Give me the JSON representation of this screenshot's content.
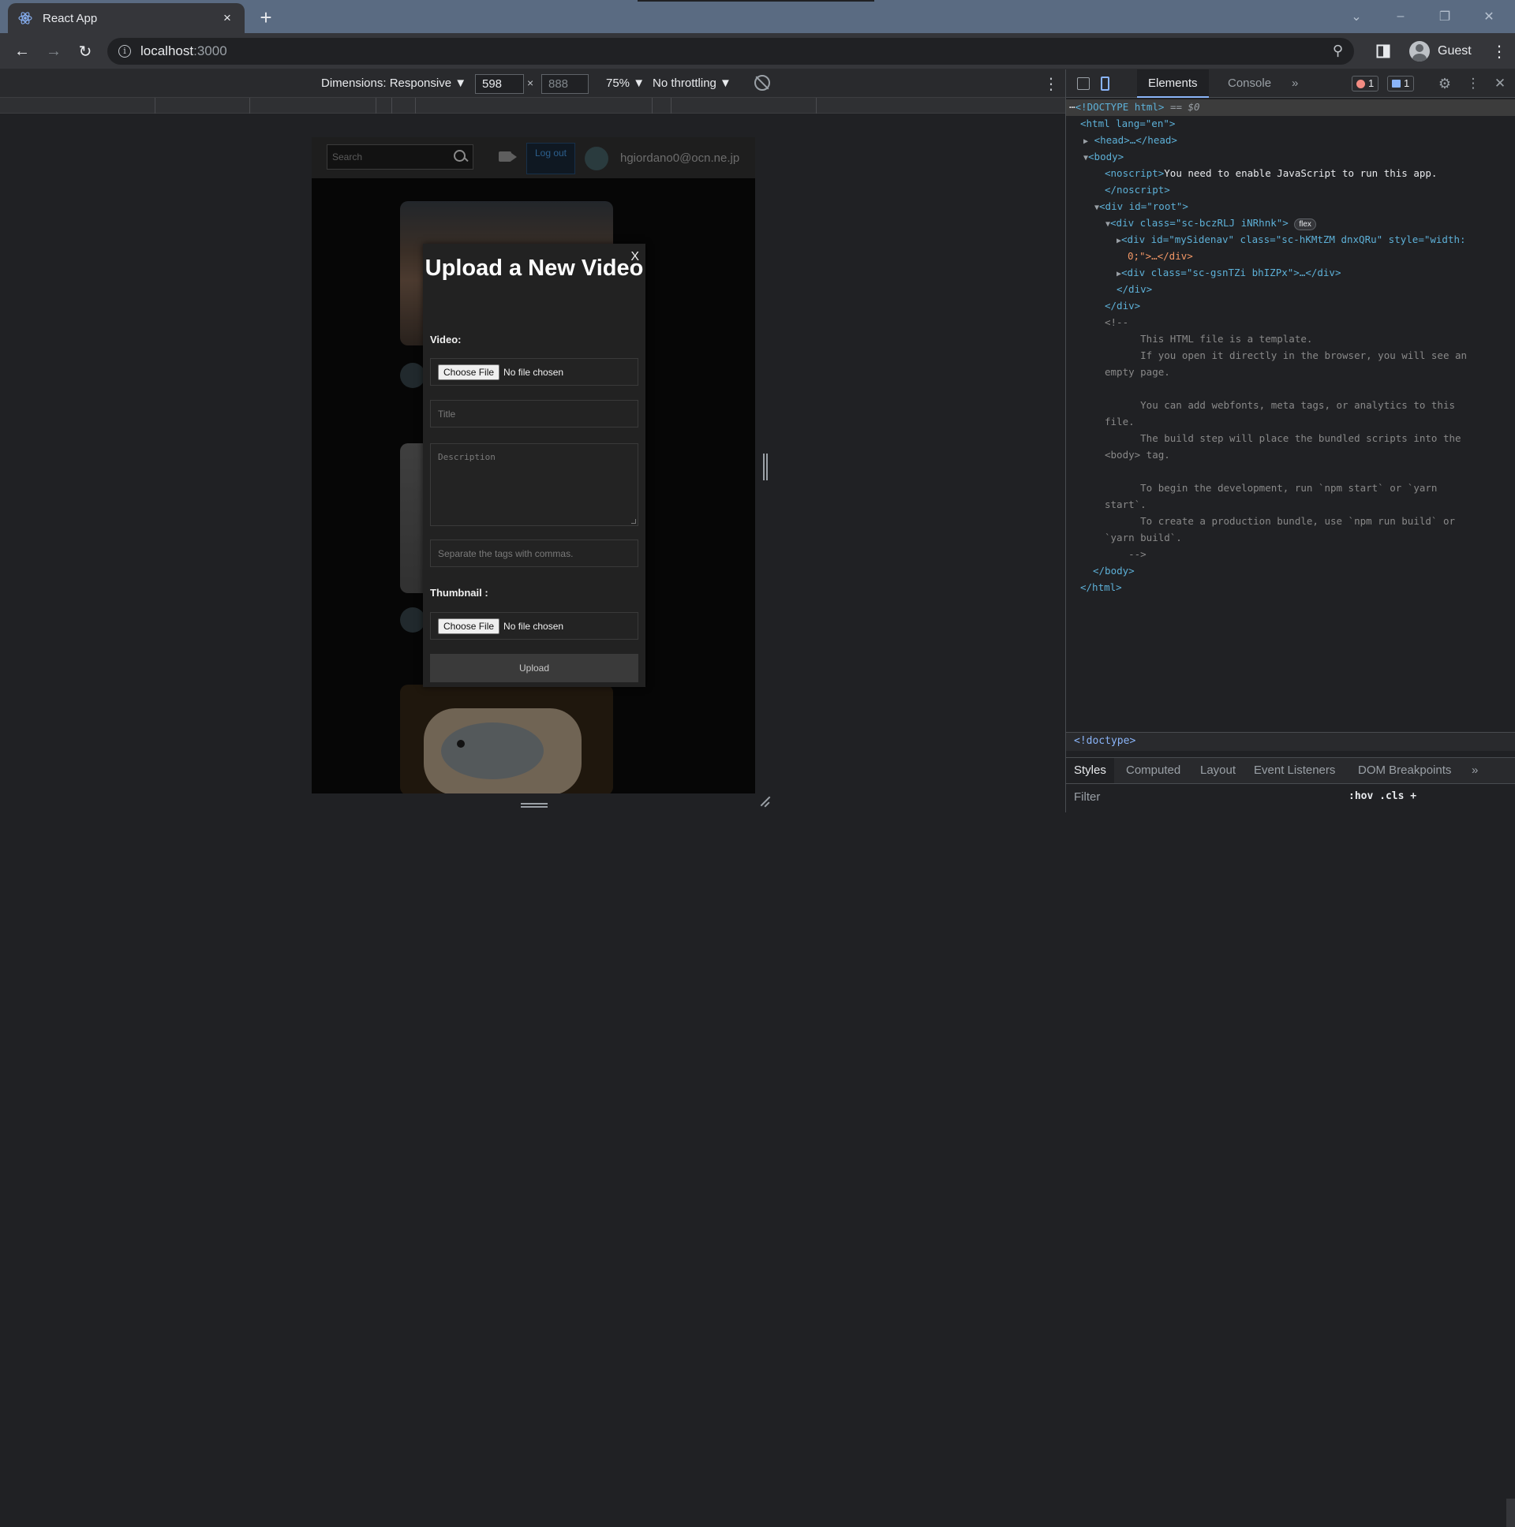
{
  "browser": {
    "tab_title": "React App",
    "tab_close": "×",
    "new_tab": "+",
    "url_host": "localhost",
    "url_port": ":3000",
    "profile_name": "Guest",
    "window_controls": [
      "⌄",
      "–",
      "❐",
      "✕"
    ]
  },
  "device_toolbar": {
    "dimensions_label": "Dimensions: Responsive ▼",
    "width_value": "598",
    "height_placeholder": "888",
    "times": "×",
    "zoom": "75% ▼",
    "throttling": "No throttling ▼"
  },
  "app": {
    "search_placeholder": "Search",
    "logout_label": "Log out",
    "user_email": "hgiordano0@ocn.ne.jp"
  },
  "modal": {
    "close_label": "X",
    "title": "Upload a New Video",
    "video_label": "Video:",
    "video_choose": "Choose File",
    "video_status": "No file chosen",
    "title_placeholder": "Title",
    "description_placeholder": "Description",
    "tags_placeholder": "Separate the tags with commas.",
    "thumbnail_label": "Thumbnail :",
    "thumbnail_choose": "Choose File",
    "thumbnail_status": "No file chosen",
    "upload_label": "Upload"
  },
  "devtools": {
    "tabs": [
      "Elements",
      "Console"
    ],
    "more_tabs": "»",
    "error_count": "1",
    "info_count": "1",
    "breadcrumb": "<!doctype>",
    "subtabs": [
      "Styles",
      "Computed",
      "Layout",
      "Event Listeners",
      "DOM Breakpoints"
    ],
    "subtabs_more": "»",
    "filter_placeholder": "Filter",
    "filter_tools": ":hov  .cls  +",
    "dom": {
      "doctype": "<!DOCTYPE html>",
      "selected_marker": " == $0",
      "html_open": "<html lang=\"en\">",
      "head": "<head>…</head>",
      "body_open": "<body>",
      "noscript_text": "You need to enable JavaScript to run this app.",
      "noscript_close": "</noscript>",
      "root_div": "<div id=\"root\">",
      "flex_div": "<div class=\"sc-bczRLJ iNRhnk\">",
      "flex_badge": "flex",
      "sidenav_a": "<div id=\"mySidenav\" class=\"sc-hKMtZM dnxQRu\" style=\"width:",
      "sidenav_b": "0;\">…</div>",
      "gsn_div": "<div class=\"sc-gsnTZi bhIZPx\">…</div>",
      "div_close": "</div>",
      "comment_lines": [
        "<!--",
        "      This HTML file is a template.",
        "      If you open it directly in the browser, you will see an",
        "empty page.",
        "",
        "      You can add webfonts, meta tags, or analytics to this",
        "file.",
        "      The build step will place the bundled scripts into the",
        "<body> tag.",
        "",
        "      To begin the development, run `npm start` or `yarn",
        "start`.",
        "      To create a production bundle, use `npm run build` or",
        "`yarn build`.",
        "    -->"
      ],
      "body_close": "</body>",
      "html_close": "</html>"
    }
  }
}
